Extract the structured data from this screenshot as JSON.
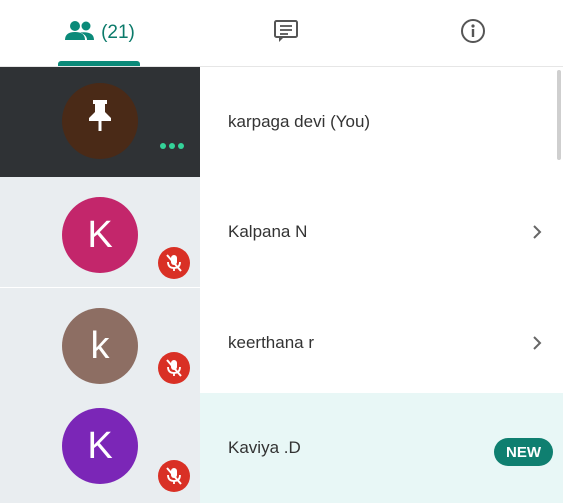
{
  "tabs": {
    "people": {
      "icon": "people-icon",
      "count_label": "(21)"
    },
    "chat": {
      "icon": "chat-icon"
    },
    "info": {
      "icon": "info-icon"
    }
  },
  "participants": [
    {
      "name": "karpaga devi (You)",
      "avatar_letter": "",
      "avatar_color": "#4a2a17",
      "icon": "pin-icon",
      "status": "more-options"
    },
    {
      "name": "Kalpana N",
      "avatar_letter": "K",
      "avatar_color": "#c3266b",
      "status": "muted"
    },
    {
      "name": "keerthana r",
      "avatar_letter": "k",
      "avatar_color": "#8d6e63",
      "status": "muted"
    },
    {
      "name": "Kaviya .D",
      "avatar_letter": "K",
      "avatar_color": "#7b26b7",
      "status": "muted",
      "badge": "NEW"
    }
  ],
  "colors": {
    "accent": "#0b8a79",
    "mute_red": "#d93025",
    "highlight_row": "#e8f7f6"
  }
}
